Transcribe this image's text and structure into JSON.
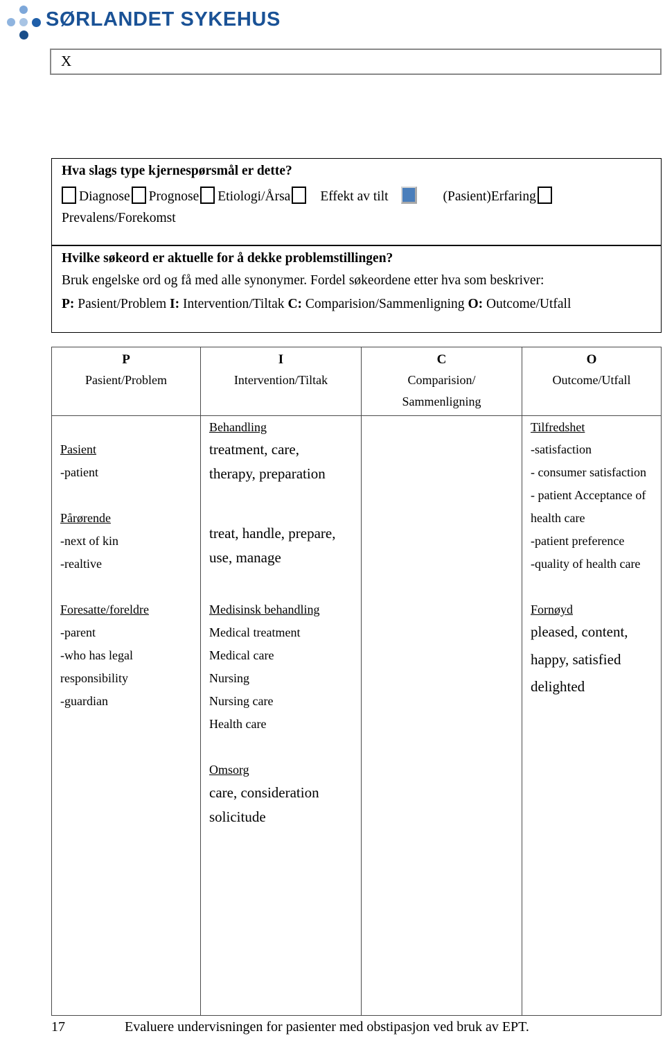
{
  "brand": {
    "name": "SØRLANDET SYKEHUS",
    "logo_colors": {
      "light": "#7da7d9",
      "medium": "#a8c4e4",
      "dark": "#1f5fa9",
      "deep": "#1a4e8a",
      "text": "#1a5296"
    }
  },
  "header_field": {
    "value": "X"
  },
  "question_1": {
    "title": "Hva slags type kjernespørsmål er dette?",
    "options": [
      {
        "label": "Diagnose",
        "checked": false
      },
      {
        "label": "Prognose",
        "checked": false
      },
      {
        "label": "Etiologi/Årsa",
        "checked": false
      },
      {
        "label": "Effekt av tilt",
        "checked": true
      },
      {
        "label": "(Pasient)Erfaring",
        "checked": false
      }
    ],
    "second_line": "Prevalens/Forekomst",
    "checked_color": "#4a7ebb"
  },
  "question_2": {
    "title": "Hvilke søkeord er aktuelle for å dekke problemstillingen?",
    "line_1": "Bruk engelske ord og få med alle synonymer. Fordel søkeordene etter hva som beskriver:",
    "line_2_parts": {
      "p_letter": "P:",
      "p_text": " Pasient/Problem ",
      "i_letter": "I:",
      "i_text": " Intervention/Tiltak ",
      "c_letter": "C:",
      "c_text": " Comparision/Sammenligning ",
      "o_letter": "O:",
      "o_text": " Outcome/Utfall"
    }
  },
  "pico_table": {
    "headers": [
      {
        "letter": "P",
        "name_line1": "Pasient/Problem",
        "name_line2": ""
      },
      {
        "letter": "I",
        "name_line1": "Intervention/Tiltak",
        "name_line2": ""
      },
      {
        "letter": "C",
        "name_line1": "Comparision/",
        "name_line2": "Sammenligning"
      },
      {
        "letter": "O",
        "name_line1": "Outcome/Utfall",
        "name_line2": ""
      }
    ],
    "column_p": {
      "block_1": {
        "heading": "Pasient",
        "lines": [
          "-patient"
        ]
      },
      "block_2": {
        "heading": "Pårørende",
        "lines": [
          "-next of kin",
          "-realtive"
        ]
      },
      "block_3": {
        "heading": "Foresatte/foreldre",
        "lines": [
          "-parent",
          "-who has legal",
          "responsibility",
          "-guardian"
        ]
      }
    },
    "column_i": {
      "block_1": {
        "heading": "Behandling",
        "lines": [
          "treatment, care,",
          "therapy, preparation"
        ]
      },
      "block_2": {
        "lines": [
          "treat, handle, prepare,",
          "use, manage"
        ]
      },
      "block_3": {
        "heading": "Medisinsk behandling",
        "lines": [
          "Medical treatment",
          "Medical care",
          "Nursing",
          "Nursing care",
          "Health care"
        ]
      },
      "block_4": {
        "heading": "Omsorg",
        "lines": [
          "care, consideration",
          "solicitude"
        ]
      }
    },
    "column_c": {
      "blocks": []
    },
    "column_o": {
      "block_1": {
        "heading": "Tilfredshet",
        "lines": [
          "-satisfaction",
          "- consumer satisfaction",
          "- patient Acceptance of",
          "health care",
          "-patient preference",
          "-quality of health care"
        ]
      },
      "block_2": {
        "heading": "Fornøyd",
        "lines": [
          "pleased, content,",
          "happy, satisfied",
          "delighted"
        ]
      }
    }
  },
  "footer": {
    "page_number": "17",
    "text": "Evaluere undervisningen for pasienter med obstipasjon ved bruk av EPT."
  }
}
